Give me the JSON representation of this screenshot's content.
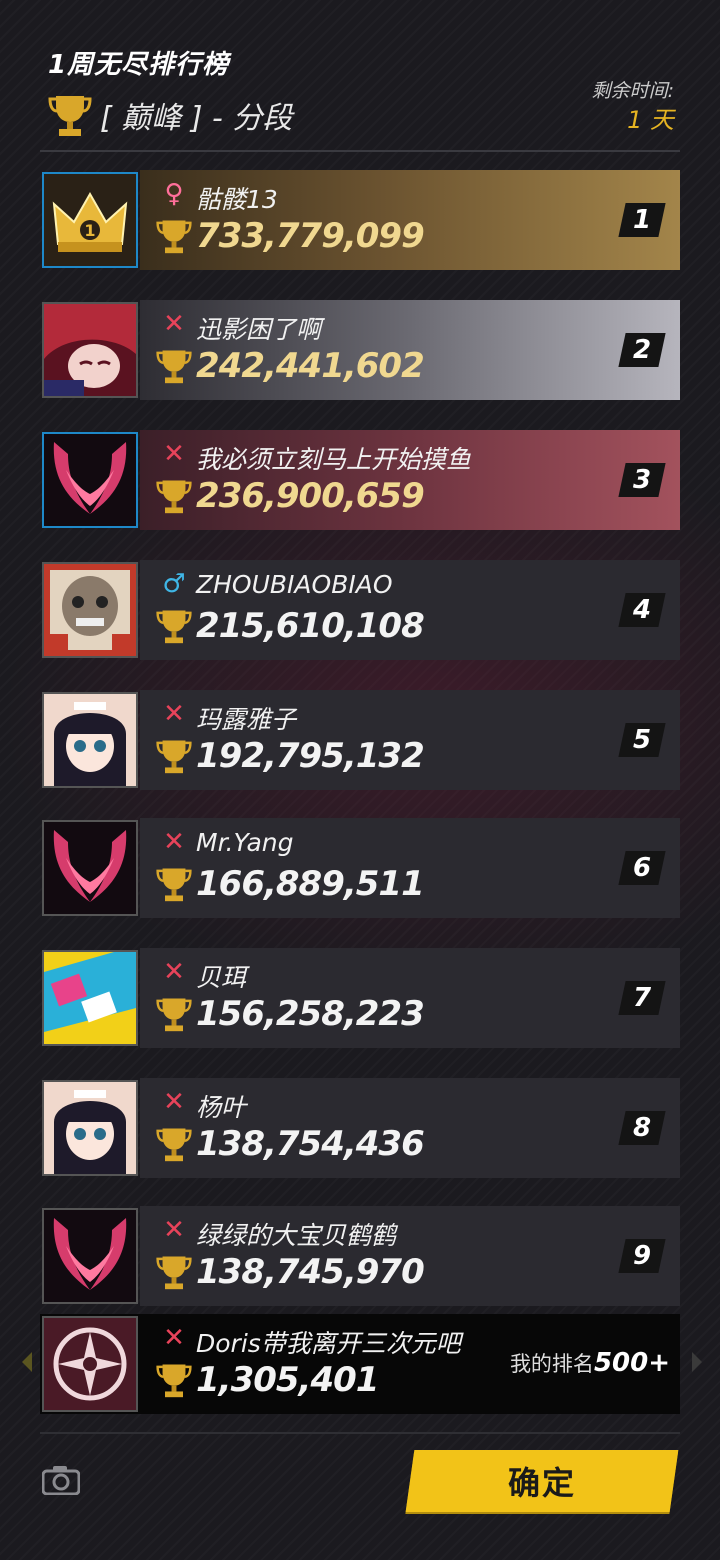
{
  "header": {
    "title": "1周无尽排行榜",
    "tier": "[ 巅峰 ] - 分段",
    "time_label": "剩余时间:",
    "time_value": "1 天"
  },
  "rows": [
    {
      "rank": "1",
      "name": "骷髅13",
      "score": "733,779,099",
      "gender": "female",
      "gender_symbol": "♀",
      "gender_color": "#ff6f9a",
      "avatar": "crown-avatar"
    },
    {
      "rank": "2",
      "name": "迅影困了啊",
      "score": "242,441,602",
      "gender": "unknown",
      "gender_symbol": "✕",
      "gender_color": "#e8435a",
      "avatar": "red-hair-avatar"
    },
    {
      "rank": "3",
      "name": "我必须立刻马上开始摸鱼",
      "score": "236,900,659",
      "gender": "unknown",
      "gender_symbol": "✕",
      "gender_color": "#e8435a",
      "avatar": "wing-avatar"
    },
    {
      "rank": "4",
      "name": "ZHOUBIAOBIAO",
      "score": "215,610,108",
      "gender": "male",
      "gender_symbol": "♂",
      "gender_color": "#3fb6e6",
      "avatar": "mask-avatar"
    },
    {
      "rank": "5",
      "name": "玛露雅子",
      "score": "192,795,132",
      "gender": "unknown",
      "gender_symbol": "✕",
      "gender_color": "#e8435a",
      "avatar": "maid-avatar"
    },
    {
      "rank": "6",
      "name": "Mr.Yang",
      "score": "166,889,511",
      "gender": "unknown",
      "gender_symbol": "✕",
      "gender_color": "#e8435a",
      "avatar": "wing-avatar"
    },
    {
      "rank": "7",
      "name": "贝珥",
      "score": "156,258,223",
      "gender": "unknown",
      "gender_symbol": "✕",
      "gender_color": "#e8435a",
      "avatar": "sticker-avatar"
    },
    {
      "rank": "8",
      "name": "杨叶",
      "score": "138,754,436",
      "gender": "unknown",
      "gender_symbol": "✕",
      "gender_color": "#e8435a",
      "avatar": "maid-avatar"
    },
    {
      "rank": "9",
      "name": "绿绿的大宝贝鹤鹤",
      "score": "138,745,970",
      "gender": "unknown",
      "gender_symbol": "✕",
      "gender_color": "#e8435a",
      "avatar": "wing-avatar"
    }
  ],
  "me": {
    "name": "Doris带我离开三次元吧",
    "score": "1,305,401",
    "gender_symbol": "✕",
    "gender_color": "#e8435a",
    "rank_label": "我的排名",
    "rank_value": "500+",
    "avatar": "emblem-avatar"
  },
  "confirm_label": "确定",
  "icons": {
    "camera": "camera-icon",
    "trophy": "trophy-icon"
  },
  "colors": {
    "gold": "#e6b422",
    "accent_blue": "#1e88c8",
    "button_yellow": "#f2c318"
  }
}
